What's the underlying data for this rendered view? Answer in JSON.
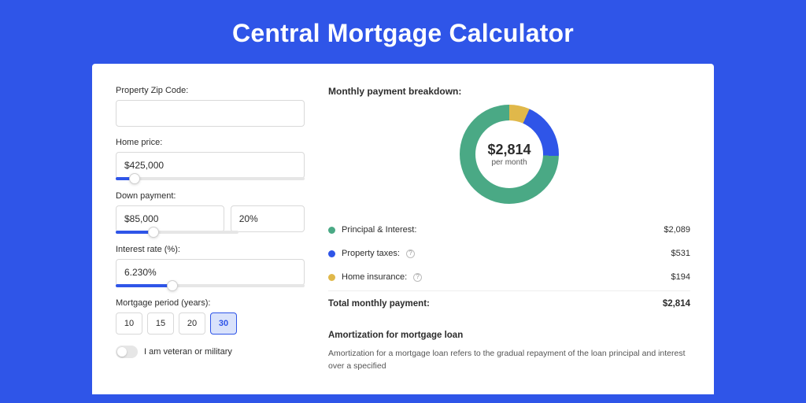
{
  "title": "Central Mortgage Calculator",
  "form": {
    "zip": {
      "label": "Property Zip Code:",
      "value": ""
    },
    "home_price": {
      "label": "Home price:",
      "value": "$425,000",
      "slider_pct": 10
    },
    "down_payment": {
      "label": "Down payment:",
      "value": "$85,000",
      "pct": "20%",
      "slider_pct": 20
    },
    "interest": {
      "label": "Interest rate (%):",
      "value": "6.230%",
      "slider_pct": 30
    },
    "period": {
      "label": "Mortgage period (years):",
      "options": [
        "10",
        "15",
        "20",
        "30"
      ],
      "selected": "30"
    },
    "veteran": {
      "label": "I am veteran or military",
      "on": false
    }
  },
  "breakdown": {
    "title": "Monthly payment breakdown:",
    "center_amount": "$2,814",
    "center_sub": "per month",
    "items": [
      {
        "label": "Principal & Interest:",
        "value": "$2,089",
        "color": "green",
        "info": false
      },
      {
        "label": "Property taxes:",
        "value": "$531",
        "color": "blue",
        "info": true
      },
      {
        "label": "Home insurance:",
        "value": "$194",
        "color": "yellow",
        "info": true
      }
    ],
    "total_label": "Total monthly payment:",
    "total_value": "$2,814"
  },
  "amortization": {
    "title": "Amortization for mortgage loan",
    "text": "Amortization for a mortgage loan refers to the gradual repayment of the loan principal and interest over a specified"
  },
  "chart_data": {
    "type": "pie",
    "title": "Monthly payment breakdown",
    "series": [
      {
        "name": "Principal & Interest",
        "value": 2089,
        "color": "#4aa985"
      },
      {
        "name": "Property taxes",
        "value": 531,
        "color": "#2f55e8"
      },
      {
        "name": "Home insurance",
        "value": 194,
        "color": "#e0b84a"
      }
    ],
    "total": 2814,
    "center_label": "$2,814 per month"
  }
}
